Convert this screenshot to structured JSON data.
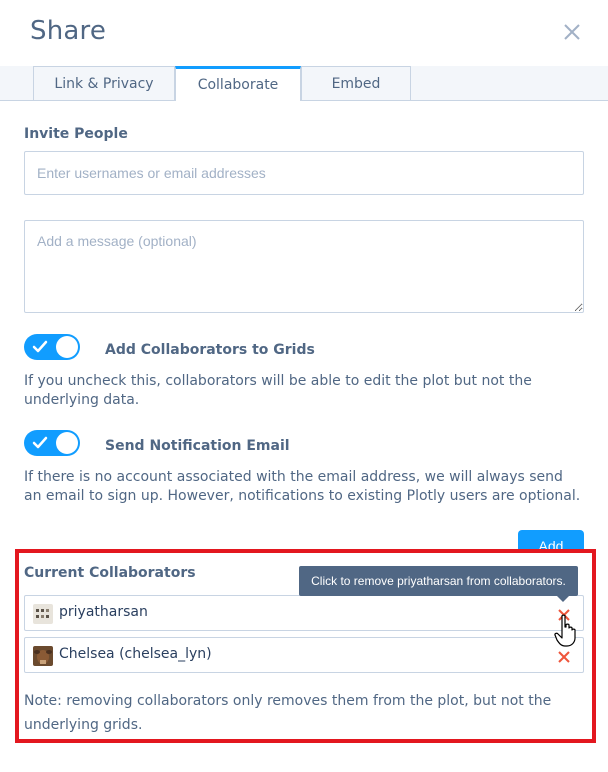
{
  "dialog": {
    "title": "Share",
    "close_icon": "close-icon"
  },
  "tabs": [
    {
      "label": "Link & Privacy",
      "active": false
    },
    {
      "label": "Collaborate",
      "active": true
    },
    {
      "label": "Embed",
      "active": false
    }
  ],
  "invite": {
    "section_label": "Invite People",
    "recipients_placeholder": "Enter usernames or email addresses",
    "recipients_value": "",
    "message_placeholder": "Add a message (optional)",
    "message_value": ""
  },
  "options": {
    "grids": {
      "label": "Add Collaborators to Grids",
      "enabled": true,
      "help": "If you uncheck this, collaborators will be able to edit the plot but not the underlying data."
    },
    "notify": {
      "label": "Send Notification Email",
      "enabled": true,
      "help": "If there is no account associated with the email address, we will always send an email to sign up. However, notifications to existing Plotly users are optional."
    }
  },
  "add_button_label": "Add",
  "collaborators": {
    "section_label": "Current Collaborators",
    "items": [
      {
        "name": "priyatharsan",
        "avatar": "pixel-avatar"
      },
      {
        "name": "Chelsea (chelsea_lyn)",
        "avatar": "photo-avatar"
      }
    ],
    "tooltip": "Click to remove priyatharsan from collaborators.",
    "note": "Note: removing collaborators only removes them from the plot, but not the underlying grids."
  },
  "colors": {
    "accent": "#119dff",
    "highlight": "#e3171f",
    "remove": "#ef553b",
    "text": "#506784"
  }
}
